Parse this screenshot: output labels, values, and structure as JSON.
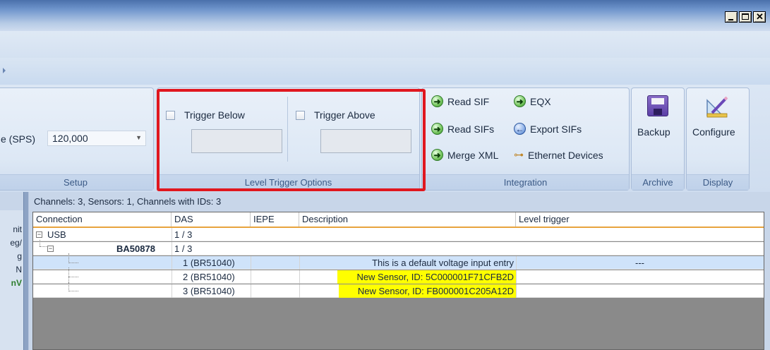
{
  "ribbon": {
    "setup": {
      "rate_label": "e (SPS)",
      "rate_value": "120,000",
      "group_label": "Setup"
    },
    "level_trigger": {
      "trigger_below_label": "Trigger Below",
      "trigger_below_value": "",
      "trigger_above_label": "Trigger Above",
      "trigger_above_value": "",
      "group_label": "Level Trigger Options"
    },
    "integration": {
      "read_sif": "Read SIF",
      "eqx": "EQX",
      "read_sifs": "Read SIFs",
      "export_sifs": "Export SIFs",
      "merge_xml": "Merge XML",
      "ethernet_devices": "Ethernet Devices",
      "group_label": "Integration"
    },
    "archive": {
      "backup": "Backup",
      "group_label": "Archive"
    },
    "display": {
      "configure": "Configure",
      "group_label": "Display"
    }
  },
  "left_panel": [
    "nit",
    "eg/",
    "g",
    "N",
    "nV"
  ],
  "info_line": "Channels: 3, Sensors: 1, Channels with IDs: 3",
  "table": {
    "headers": {
      "connection": "Connection",
      "das": "DAS",
      "iepe": "IEPE",
      "description": "Description",
      "level_trigger": "Level trigger"
    },
    "rows": {
      "usb": {
        "connection": "USB",
        "das": "1 / 3"
      },
      "device": {
        "connection": "BA50878",
        "das": "1 / 3"
      },
      "ch1": {
        "das": "1 (BR51040)",
        "description": "This is a default voltage input entry",
        "level_trigger": "---"
      },
      "ch2": {
        "das": "2 (BR51040)",
        "description": "New Sensor, ID: 5C000001F71CFB2D"
      },
      "ch3": {
        "das": "3 (BR51040)",
        "description": "New Sensor, ID: FB000001C205A12D"
      }
    }
  },
  "colors": {
    "highlight_border": "#e0171f",
    "sensor_id_highlight": "#ffff00",
    "selected_row": "#cfe3fa",
    "header_underline": "#e8a33d"
  }
}
